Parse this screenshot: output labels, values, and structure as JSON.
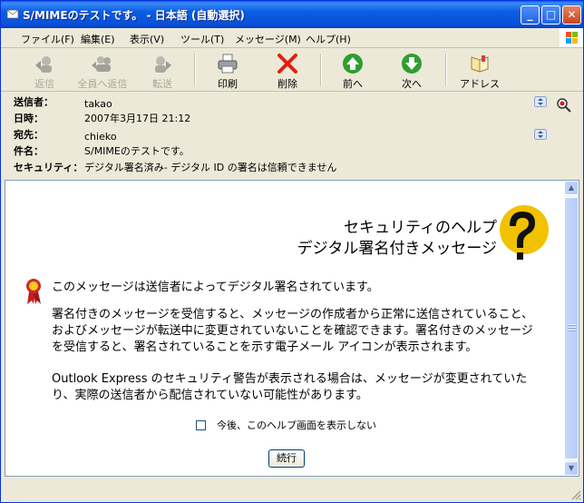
{
  "window": {
    "title": "S/MIMEのテストです。 - 日本語 (自動選択)",
    "minimize": "_",
    "maximize": "□",
    "close": "✕"
  },
  "menu": {
    "items": [
      "ファイル(F)",
      "編集(E)",
      "表示(V)",
      "ツール(T)",
      "メッセージ(M)",
      "ヘルプ(H)"
    ]
  },
  "toolbar": {
    "reply": "返信",
    "reply_all": "全員へ返信",
    "forward": "転送",
    "print": "印刷",
    "delete": "削除",
    "previous": "前へ",
    "next": "次へ",
    "address": "アドレス"
  },
  "header": {
    "from_label": "送信者：",
    "from_value": "takao",
    "date_label": "日時：",
    "date_value": "2007年3月17日 21:12",
    "to_label": "宛先：",
    "to_value": "chieko",
    "subject_label": "件名：",
    "subject_value": "S/MIMEのテストです。",
    "security_label": "セキュリティ：",
    "security_value": "デジタル署名済み- デジタル ID の署名は信頼できません"
  },
  "help": {
    "title_line1": "セキュリティのヘルプ",
    "title_line2": "デジタル署名付きメッセージ",
    "intro": "このメッセージは送信者によってデジタル署名されています。",
    "paragraph1": "署名付きのメッセージを受信すると、メッセージの作成者から正常に送信されていること、およびメッセージが転送中に変更されていないことを確認できます。署名付きのメッセージを受信すると、署名されていることを示す電子メール アイコンが表示されます。",
    "paragraph2": "Outlook Express のセキュリティ警告が表示される場合は、メッセージが変更されていたり、実際の送信者から配信されていない可能性があります。",
    "dont_show_label": "今後、このヘルプ画面を表示しない",
    "dont_show_checked": false,
    "continue_button": "続行"
  },
  "icons": {
    "window": "envelope-icon",
    "reply": "reply-icon",
    "reply_all": "reply-all-icon",
    "forward": "forward-icon",
    "print": "printer-icon",
    "delete": "red-x-icon",
    "previous": "green-up-arrow-icon",
    "next": "green-down-arrow-icon",
    "address": "address-book-icon",
    "security": "certificate-ribbon-icon",
    "help": "question-mark-icon"
  },
  "colors": {
    "titlebar": "#0b5ce3",
    "delete_red": "#e02010",
    "nav_green": "#2e9e2e",
    "help_yellow": "#f2c200"
  }
}
